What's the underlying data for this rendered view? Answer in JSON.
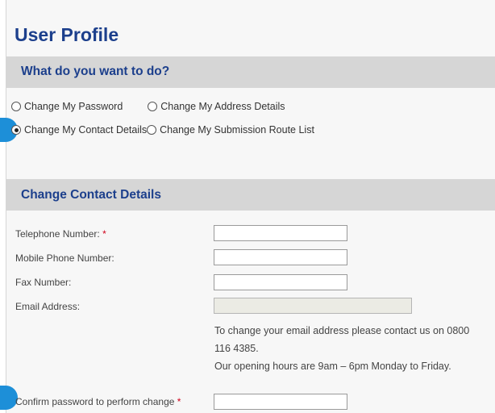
{
  "page": {
    "title": "User Profile"
  },
  "what_section": {
    "heading": "What do you want to do?",
    "options": [
      {
        "label": "Change My Password",
        "checked": false
      },
      {
        "label": "Change My Address Details",
        "checked": false
      },
      {
        "label": "Change My Contact Details",
        "checked": true
      },
      {
        "label": "Change My Submission Route List",
        "checked": false
      }
    ]
  },
  "contact_section": {
    "heading": "Change Contact Details",
    "fields": {
      "telephone": {
        "label": "Telephone Number:",
        "required_mark": "*",
        "value": ""
      },
      "mobile": {
        "label": "Mobile Phone Number:",
        "value": ""
      },
      "fax": {
        "label": "Fax Number:",
        "value": ""
      },
      "email": {
        "label": "Email Address:",
        "value": ""
      }
    },
    "email_info_line1": "To change your email address please contact us on 0800",
    "email_info_line2": "116 4385.",
    "email_info_line3": "Our opening hours are 9am – 6pm Monday to Friday.",
    "confirm_password": {
      "label": "Confirm password to perform change",
      "required_mark": "*",
      "value": ""
    }
  },
  "colors": {
    "heading_blue": "#1c3f8c",
    "band_gray": "#d6d6d6",
    "required_red": "#d0021b",
    "marker_blue": "#1d8fd8"
  }
}
